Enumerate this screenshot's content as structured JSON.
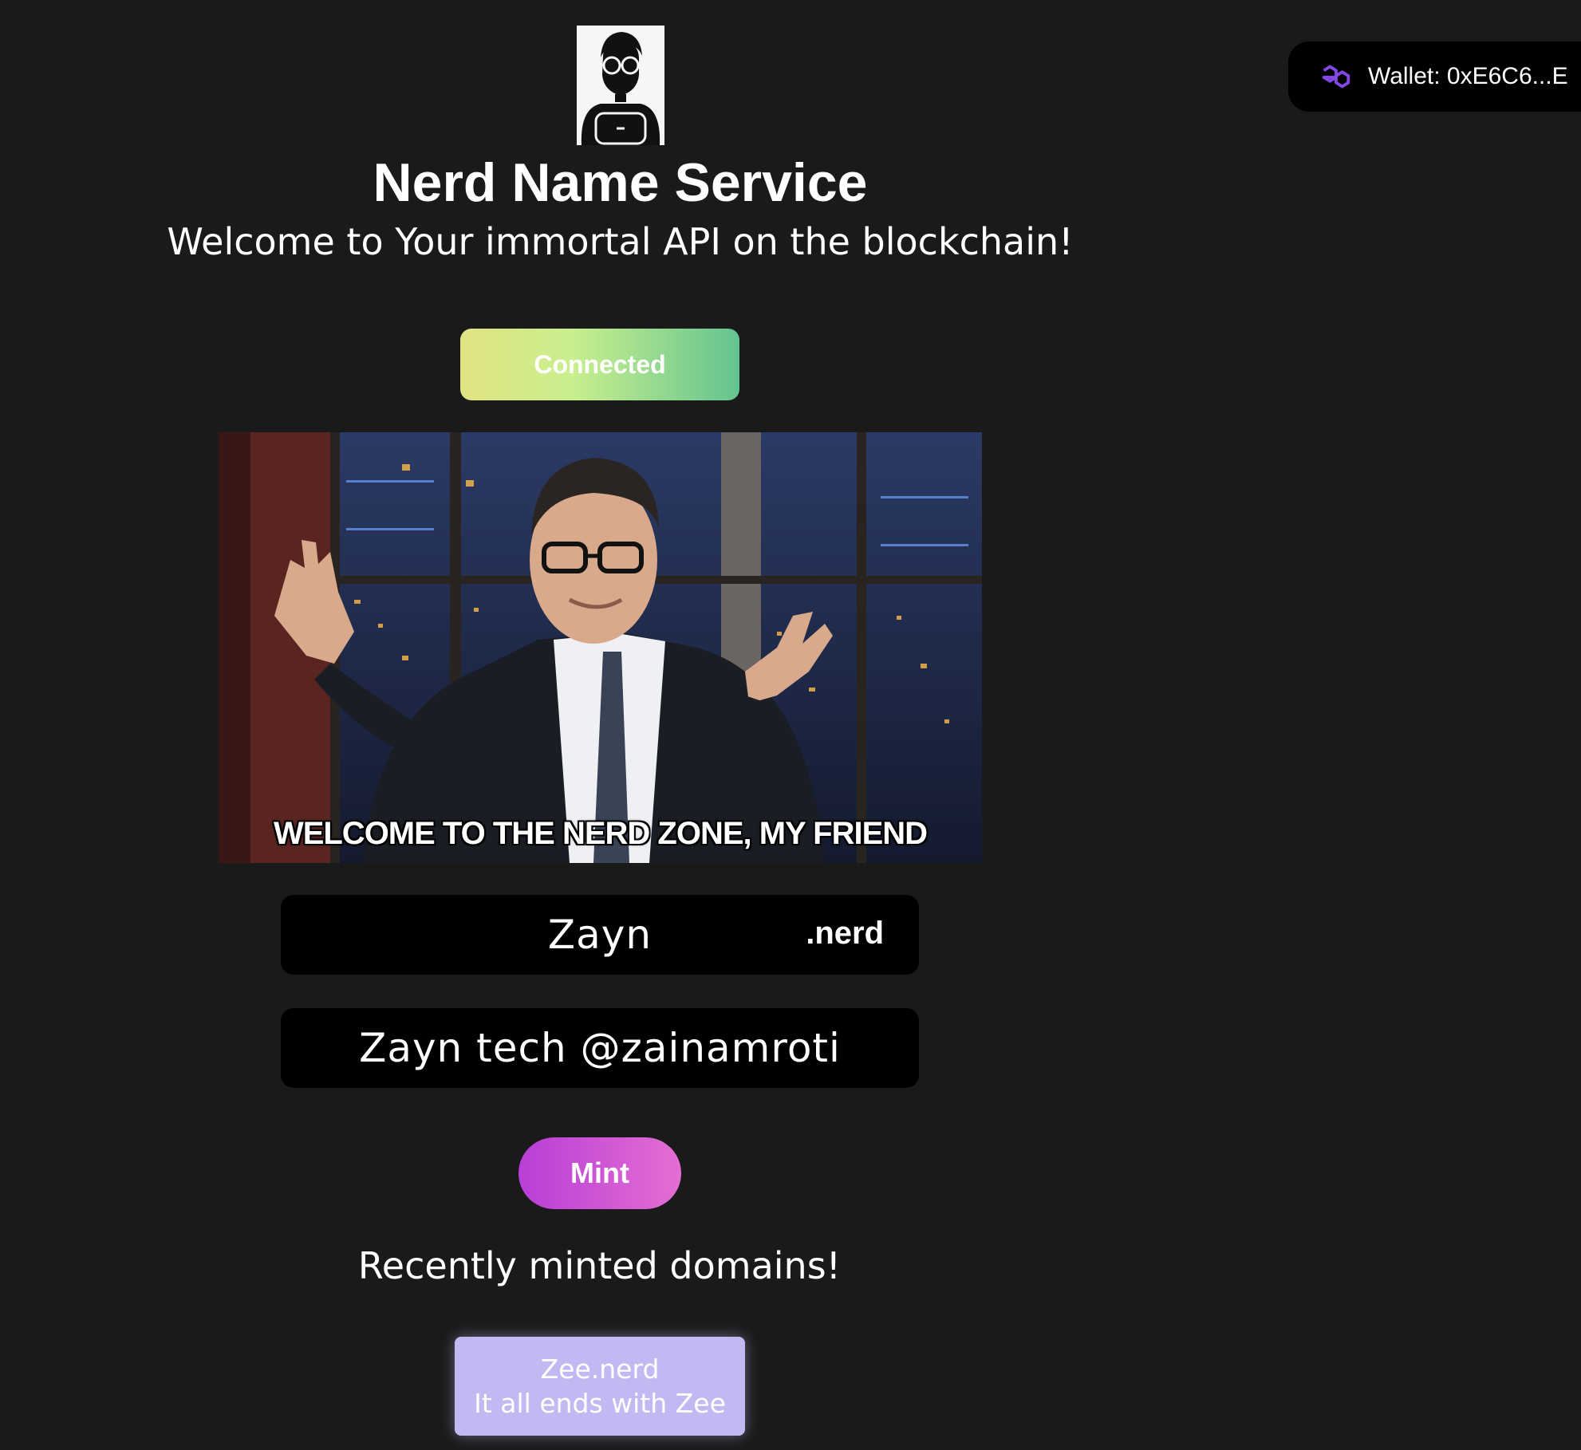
{
  "header": {
    "title": "Nerd Name Service",
    "subtitle": "Welcome to Your immortal API on the blockchain!",
    "logo_icon": "nerd-avatar-icon"
  },
  "wallet": {
    "label": "Wallet: 0xE6C6...E",
    "icon": "polygon-icon",
    "icon_color": "#8247e5"
  },
  "connect_button": {
    "label": "Connected"
  },
  "hero_gif": {
    "caption": "WELCOME TO THE NERD ZONE, MY FRIEND"
  },
  "form": {
    "domain_value": "Zayn",
    "tld": ".nerd",
    "record_value": "Zayn tech @zainamroti",
    "mint_label": "Mint"
  },
  "recent": {
    "title": "Recently minted domains!",
    "items": [
      {
        "domain": "Zee.nerd",
        "record": "It all ends with Zee"
      }
    ]
  },
  "colors": {
    "background": "#1a1a1a",
    "connected_gradient": [
      "#e2e383",
      "#63c490"
    ],
    "mint_gradient": [
      "#b83ed6",
      "#e46ed3"
    ],
    "domain_card": "#c4b8f3"
  }
}
